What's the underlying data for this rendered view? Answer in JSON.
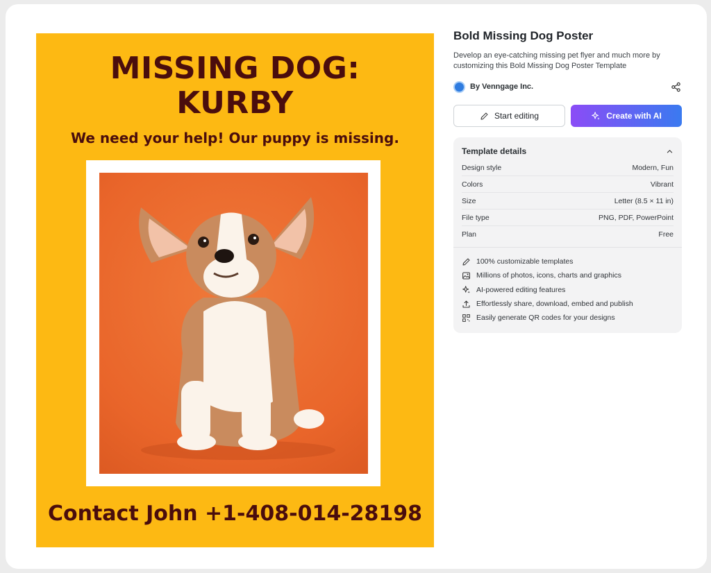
{
  "poster": {
    "title_line1": "MISSING DOG:",
    "title_line2": "KURBY",
    "subtitle": "We need your help! Our puppy is missing.",
    "contact": "Contact John +1-408-014-28198",
    "background_color": "#fdb913",
    "text_color": "#4a0d0d"
  },
  "template": {
    "title": "Bold Missing Dog Poster",
    "description": "Develop an eye-catching missing pet flyer and much more by customizing this Bold Missing Dog Poster Template",
    "author": "By Venngage Inc.",
    "share_icon": "share-icon"
  },
  "actions": {
    "start_editing": "Start editing",
    "create_with_ai": "Create with AI"
  },
  "details": {
    "heading": "Template details",
    "rows": [
      {
        "label": "Design style",
        "value": "Modern, Fun"
      },
      {
        "label": "Colors",
        "value": "Vibrant"
      },
      {
        "label": "Size",
        "value": "Letter (8.5 × 11 in)"
      },
      {
        "label": "File type",
        "value": "PNG, PDF, PowerPoint"
      },
      {
        "label": "Plan",
        "value": "Free"
      }
    ],
    "features": [
      {
        "icon": "pencil-icon",
        "text": "100% customizable templates"
      },
      {
        "icon": "image-icon",
        "text": "Millions of photos, icons, charts and graphics"
      },
      {
        "icon": "sparkle-icon",
        "text": "AI-powered editing features"
      },
      {
        "icon": "upload-icon",
        "text": "Effortlessly share, download, embed and publish"
      },
      {
        "icon": "qr-code-icon",
        "text": "Easily generate QR codes for your designs"
      }
    ]
  },
  "colors": {
    "ai_gradient_start": "#8b4cf6",
    "ai_gradient_end": "#3a7af0"
  }
}
